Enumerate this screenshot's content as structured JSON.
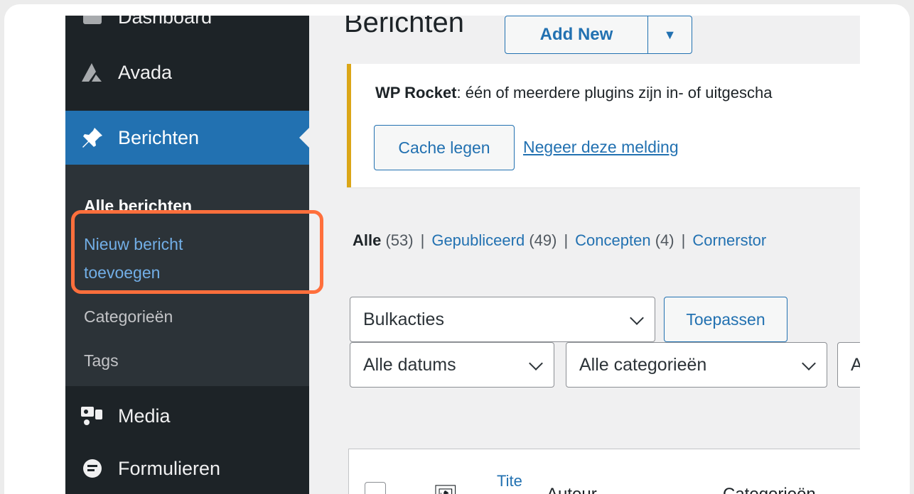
{
  "sidebar": {
    "dashboard": "Dashboard",
    "avada": "Avada",
    "posts": "Berichten",
    "submenu": {
      "all": "Alle berichten",
      "new": "Nieuw bericht toevoegen",
      "categories": "Categorieën",
      "tags": "Tags"
    },
    "media": "Media",
    "forms": "Formulieren"
  },
  "header": {
    "title": "Berichten",
    "add_new": "Add New"
  },
  "notice": {
    "brand": "WP Rocket",
    "message": ": één of meerdere plugins zijn in- of uitgescha",
    "cache_button": "Cache legen",
    "dismiss_link": "Negeer deze melding"
  },
  "filters": {
    "all": "Alle",
    "all_count": "(53)",
    "published": "Gepubliceerd",
    "published_count": "(49)",
    "drafts": "Concepten",
    "drafts_count": "(4)",
    "cornerstone": "Cornerstor"
  },
  "bulk": {
    "select": "Bulkacties",
    "apply": "Toepassen"
  },
  "dates_filter": "Alle datums",
  "categories_filter": "Alle categorieën",
  "third_filter": "A",
  "table": {
    "col_title": "Tite",
    "col_author": "Auteur",
    "col_categories": "Categorieën"
  },
  "colors": {
    "accent": "#2271b1",
    "highlight": "#ff6f3c",
    "notice_border": "#dba617"
  }
}
